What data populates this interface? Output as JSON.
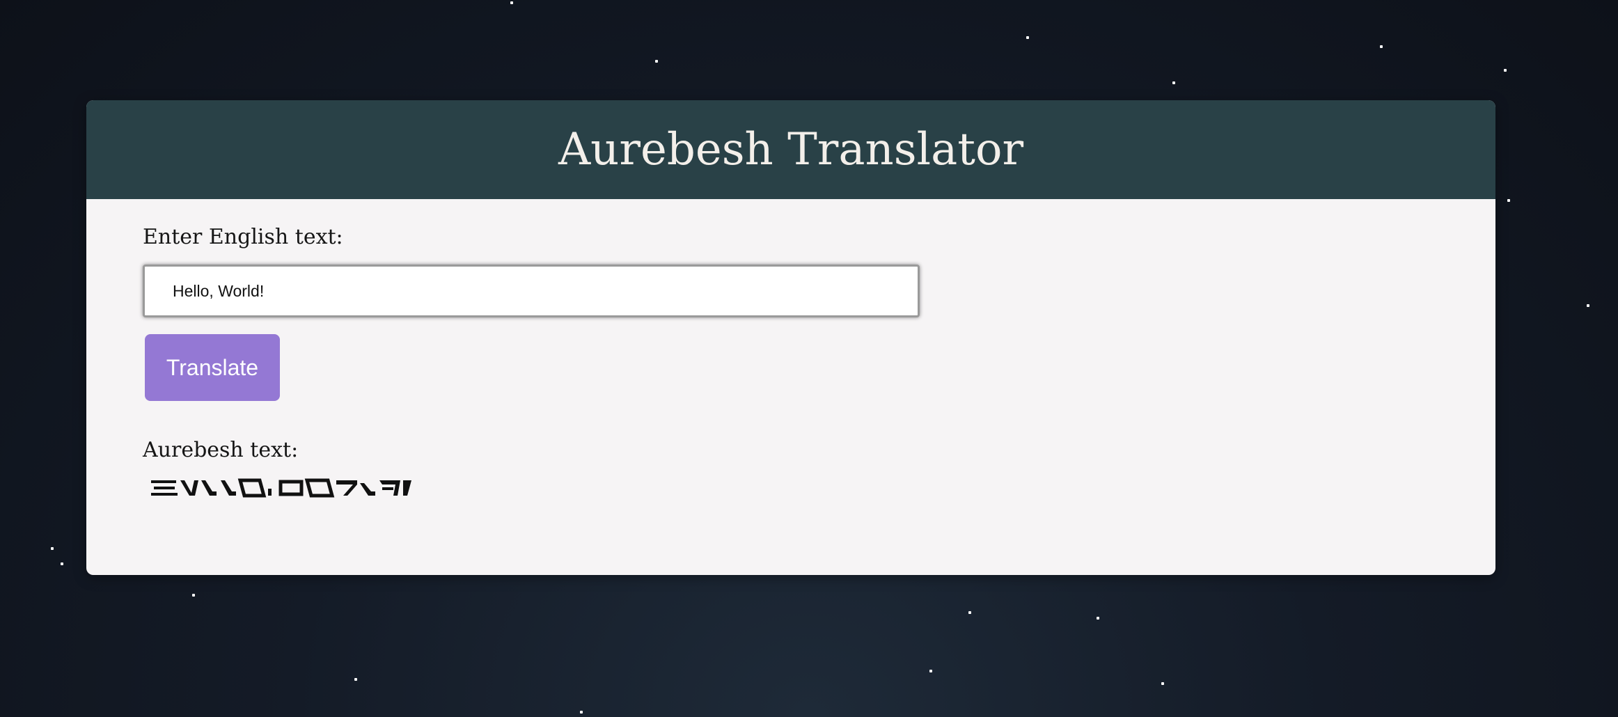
{
  "app": {
    "title": "Aurebesh Translator"
  },
  "form": {
    "input_label": "Enter English text:",
    "input_value": "Hello, World!",
    "translate_label": "Translate"
  },
  "output": {
    "label": "Aurebesh text:",
    "text": "Hello, World!"
  },
  "colors": {
    "header_bg": "#294147",
    "card_bg": "#f6f4f5",
    "button_bg": "#9478d4",
    "page_bg": "#141b27"
  }
}
